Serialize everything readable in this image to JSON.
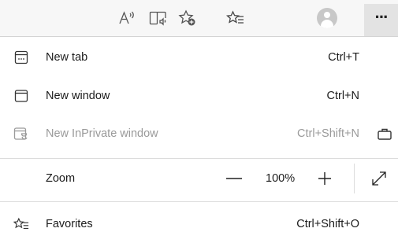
{
  "toolbar": {
    "buttons": [
      {
        "name": "read-aloud"
      },
      {
        "name": "immersive-reader"
      },
      {
        "name": "add-to-favorites"
      },
      {
        "name": "favorites"
      },
      {
        "name": "profile"
      },
      {
        "name": "settings-and-more",
        "label": "···"
      }
    ]
  },
  "menu": {
    "new_tab": {
      "label": "New tab",
      "shortcut": "Ctrl+T",
      "icon": "new-tab-icon"
    },
    "new_window": {
      "label": "New window",
      "shortcut": "Ctrl+N",
      "icon": "new-window-icon"
    },
    "new_inprivate": {
      "label": "New InPrivate window",
      "shortcut": "Ctrl+Shift+N",
      "icon": "inprivate-icon",
      "disabled": true
    },
    "zoom": {
      "label": "Zoom",
      "minus": "—",
      "value": "100%",
      "plus": "+",
      "icon": "fullscreen-icon"
    },
    "favorites": {
      "label": "Favorites",
      "shortcut": "Ctrl+Shift+O",
      "icon": "favorites-icon"
    }
  },
  "colors": {
    "toolbar_bg": "#f7f7f7",
    "active_btn": "#e3e3e3",
    "disabled_text": "#9a9a9a"
  }
}
